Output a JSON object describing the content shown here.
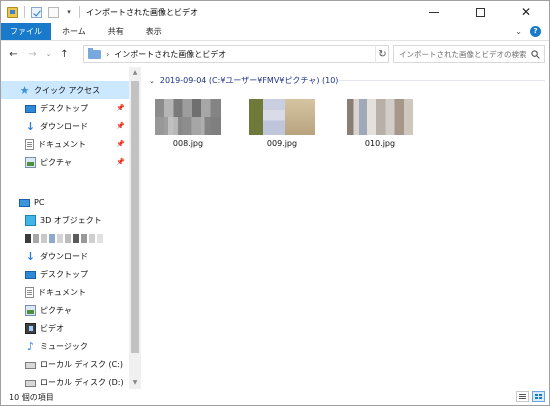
{
  "window": {
    "title": "インポートされた画像とビデオ",
    "quick_access_toolbar": [
      "app-icon",
      "properties-icon",
      "new-folder-icon",
      "customize-dropdown-icon"
    ],
    "controls": [
      "minimize",
      "maximize",
      "close"
    ]
  },
  "ribbon": {
    "tabs": [
      "ファイル",
      "ホーム",
      "共有",
      "表示"
    ],
    "accent_color": "#1979ca"
  },
  "address": {
    "path": "インポートされた画像とビデオ",
    "search_placeholder": "インポートされた画像とビデオの検索"
  },
  "nav": {
    "quick_access": {
      "label": "クイック アクセス",
      "items": [
        {
          "label": "デスクトップ",
          "icon": "desktop-icon",
          "pinned": true
        },
        {
          "label": "ダウンロード",
          "icon": "download-icon",
          "pinned": true
        },
        {
          "label": "ドキュメント",
          "icon": "documents-icon",
          "pinned": true
        },
        {
          "label": "ピクチャ",
          "icon": "pictures-icon",
          "pinned": true
        }
      ]
    },
    "pc": {
      "label": "PC",
      "items": [
        {
          "label": "3D オブジェクト",
          "icon": "3d-objects-icon"
        },
        {
          "label": "ダウンロード",
          "icon": "download-icon"
        },
        {
          "label": "デスクトップ",
          "icon": "desktop-icon"
        },
        {
          "label": "ドキュメント",
          "icon": "documents-icon"
        },
        {
          "label": "ピクチャ",
          "icon": "pictures-icon"
        },
        {
          "label": "ビデオ",
          "icon": "videos-icon"
        },
        {
          "label": "ミュージック",
          "icon": "music-icon"
        },
        {
          "label": "ローカル ディスク (C:)",
          "icon": "drive-icon"
        },
        {
          "label": "ローカル ディスク (D:)",
          "icon": "drive-icon"
        }
      ]
    }
  },
  "content": {
    "group_header": "2019-09-04 (C:¥ユーザー¥FMV¥ピクチャ) (10)",
    "files": [
      {
        "name": "008.jpg"
      },
      {
        "name": "009.jpg"
      },
      {
        "name": "010.jpg"
      }
    ]
  },
  "status": {
    "item_count": "10 個の項目",
    "view_modes": [
      "details-view-icon",
      "large-icons-view-icon"
    ],
    "active_view": "large-icons-view-icon"
  }
}
